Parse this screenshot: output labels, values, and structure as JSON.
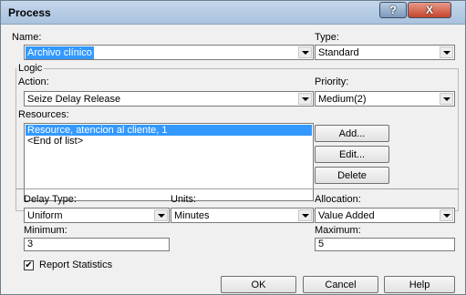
{
  "window": {
    "title": "Process",
    "help_button": "?",
    "close_button": "X"
  },
  "fields": {
    "name_label": "Name:",
    "name_value": "Archivo clínico",
    "type_label": "Type:",
    "type_value": "Standard"
  },
  "logic": {
    "group_title": "Logic",
    "action_label": "Action:",
    "action_value": "Seize Delay Release",
    "priority_label": "Priority:",
    "priority_value": "Medium(2)",
    "resources_label": "Resources:",
    "resources": [
      "Resource, atencion al cliente, 1",
      "<End of list>"
    ],
    "add_button": "Add...",
    "edit_button": "Edit...",
    "delete_button": "Delete"
  },
  "delay": {
    "delay_type_label": "Delay Type:",
    "delay_type_value": "Uniform",
    "units_label": "Units:",
    "units_value": "Minutes",
    "allocation_label": "Allocation:",
    "allocation_value": "Value Added",
    "minimum_label": "Minimum:",
    "minimum_value": "3",
    "maximum_label": "Maximum:",
    "maximum_value": "5"
  },
  "report_statistics": {
    "label": "Report Statistics",
    "checked": true,
    "check_glyph": "✔"
  },
  "footer": {
    "ok_button": "OK",
    "cancel_button": "Cancel",
    "help_button": "Help"
  }
}
